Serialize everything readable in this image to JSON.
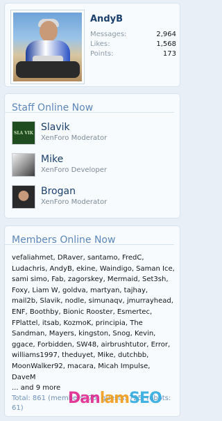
{
  "visitor": {
    "username": "AndyB",
    "stats": [
      {
        "label": "Messages:",
        "value": "2,964"
      },
      {
        "label": "Likes:",
        "value": "1,568"
      },
      {
        "label": "Points:",
        "value": "173"
      }
    ]
  },
  "staff_online": {
    "title": "Staff Online Now",
    "members": [
      {
        "name": "Slavik",
        "role": "XenForo Moderator",
        "avatar_text": "SLA VIK"
      },
      {
        "name": "Mike",
        "role": "XenForo Developer"
      },
      {
        "name": "Brogan",
        "role": "XenForo Moderator"
      }
    ]
  },
  "members_online": {
    "title": "Members Online Now",
    "members_list": "vefaliahmet, DRaver, santamo, FredC, Ludachris, AndyB, ekine, Waindigo, Saman Ice, sami simo, Fab, zagorskey, Mermaid, Set3sh, Foxy, Liam W, goldva, martyan, tajhay, mail2b, Slavik, nodle, simunaqv, jmurrayhead, ENF, Boothby, Bionic Rooster, Esmertec, FPlattel, itsab, KozmoK, principia, The Sandman, Mayers, kingston, Snog, Kevin, ggace, Forbidden, SW48, airbrushtutor, Error, williams1997, theduyet, Mike, dutchbb, MoonWalker92, macara, Micah Impulse, DaveM",
    "more_text": "... and 9 more",
    "totals_text": "Total: 861 (members: 75, guests: 725, robots: 61)"
  },
  "watermark": {
    "part1": "Dan",
    "part2": "lam",
    "part3": "SEO"
  }
}
